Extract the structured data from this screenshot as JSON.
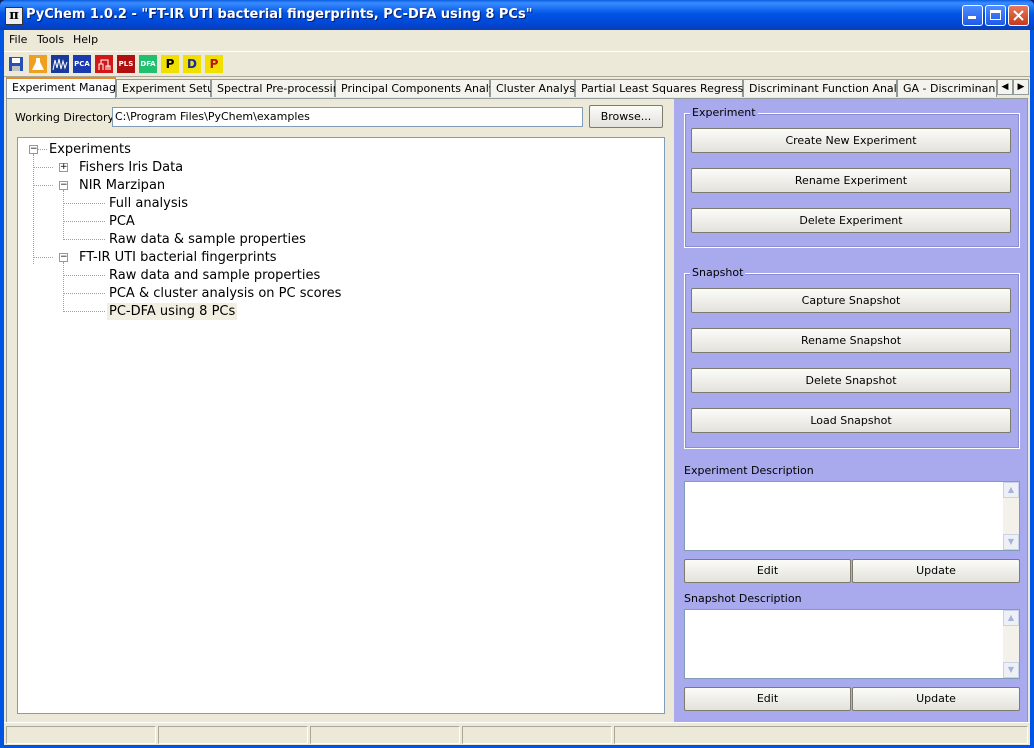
{
  "window": {
    "title": "PyChem 1.0.2 - \"FT-IR UTI bacterial fingerprints, PC-DFA using 8 PCs\"",
    "icon_glyph": "π"
  },
  "menu": [
    "File",
    "Tools",
    "Help"
  ],
  "toolbar": {
    "icons": [
      {
        "name": "save-icon",
        "glyph": ""
      },
      {
        "name": "flask-icon",
        "glyph": ""
      },
      {
        "name": "spectra-icon",
        "glyph": ""
      },
      {
        "name": "pca-icon",
        "glyph": "PCA"
      },
      {
        "name": "cluster-icon",
        "glyph": ""
      },
      {
        "name": "pls-icon",
        "glyph": "PLS"
      },
      {
        "name": "dfa-icon",
        "glyph": "DFA"
      },
      {
        "name": "ga-pls-icon",
        "glyph": "P"
      },
      {
        "name": "ga-dfa-icon",
        "glyph": "D"
      },
      {
        "name": "ga-plsr-icon",
        "glyph": "P"
      }
    ]
  },
  "tabs": [
    "Experiment Manager",
    "Experiment Setup",
    "Spectral Pre-processing",
    "Principal Components Analysis",
    "Cluster Analysis",
    "Partial Least Squares Regression",
    "Discriminant Function Analysis",
    "GA - Discriminant PL"
  ],
  "working_directory": {
    "label": "Working Directory",
    "value": "C:\\Program Files\\PyChem\\examples",
    "browse_label": "Browse..."
  },
  "tree": {
    "root": "Experiments",
    "nodes": [
      {
        "label": "Fishers Iris Data"
      },
      {
        "label": "NIR Marzipan"
      },
      {
        "label": "Full analysis"
      },
      {
        "label": "PCA"
      },
      {
        "label": "Raw data & sample properties"
      },
      {
        "label": "FT-IR UTI bacterial fingerprints"
      },
      {
        "label": "Raw data and sample properties"
      },
      {
        "label": "PCA & cluster analysis on PC scores"
      },
      {
        "label": "PC-DFA using 8 PCs"
      }
    ]
  },
  "experiment_group": {
    "title": "Experiment",
    "create": "Create New Experiment",
    "rename": "Rename Experiment",
    "delete": "Delete Experiment"
  },
  "snapshot_group": {
    "title": "Snapshot",
    "capture": "Capture Snapshot",
    "rename": "Rename Snapshot",
    "delete": "Delete Snapshot",
    "load": "Load Snapshot"
  },
  "experiment_description": {
    "label": "Experiment Description",
    "edit": "Edit",
    "update": "Update"
  },
  "snapshot_description": {
    "label": "Snapshot Description",
    "edit": "Edit",
    "update": "Update"
  },
  "colors": {
    "right_panel": "#a9a9ee",
    "titlebar": "#0054e3",
    "active_tab_accent": "#e68b2c"
  }
}
